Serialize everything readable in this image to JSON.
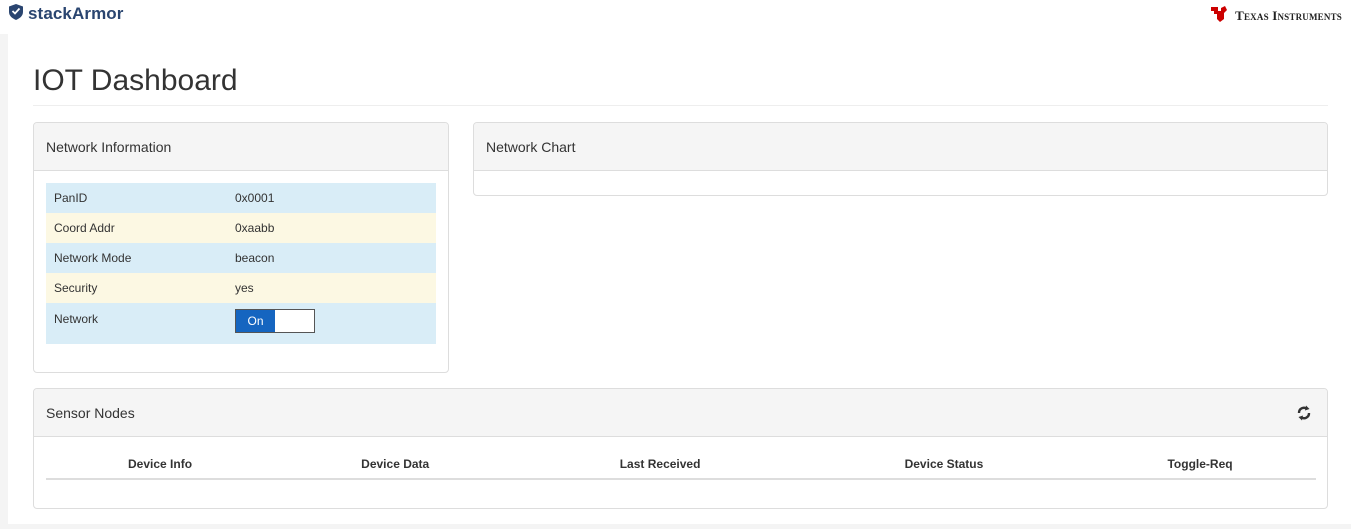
{
  "header": {
    "brand": "stackArmor",
    "partner": "Texas Instruments"
  },
  "page": {
    "title": "IOT Dashboard"
  },
  "network_info": {
    "title": "Network Information",
    "rows": [
      {
        "label": "PanID",
        "value": "0x0001"
      },
      {
        "label": "Coord Addr",
        "value": "0xaabb"
      },
      {
        "label": "Network Mode",
        "value": "beacon"
      },
      {
        "label": "Security",
        "value": "yes"
      }
    ],
    "network_label": "Network",
    "toggle_on_label": "On"
  },
  "network_chart": {
    "title": "Network Chart"
  },
  "sensor_nodes": {
    "title": "Sensor Nodes",
    "columns": [
      "Device Info",
      "Device Data",
      "Last Received",
      "Device Status",
      "Toggle-Req"
    ]
  },
  "colors": {
    "brand": "#2a4570",
    "ti_red": "#cc0000",
    "toggle_on": "#1565c0",
    "row_info": "#d9edf7",
    "row_warning": "#fcf8e3"
  },
  "icons": {
    "brand_logo": "shield-icon",
    "partner_logo": "ti-logo-icon",
    "refresh": "refresh-icon"
  }
}
